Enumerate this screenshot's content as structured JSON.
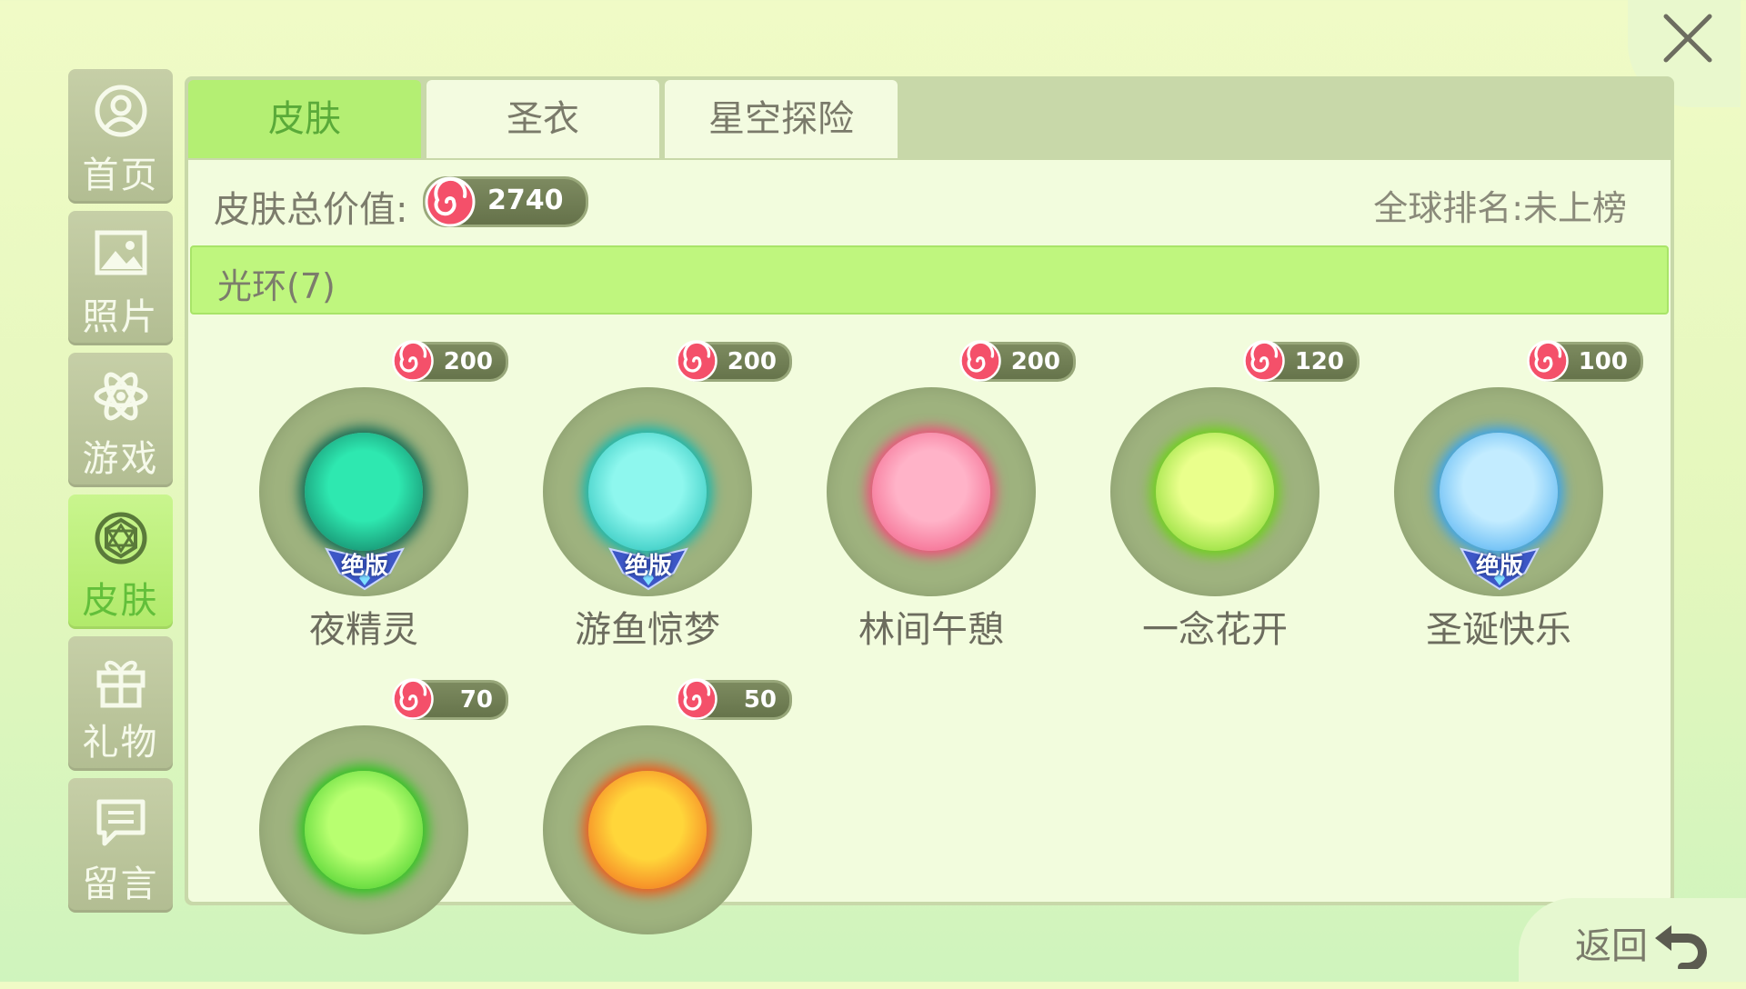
{
  "sidebar": {
    "items": [
      {
        "label": "首页",
        "icon": "profile-icon"
      },
      {
        "label": "照片",
        "icon": "photo-icon"
      },
      {
        "label": "游戏",
        "icon": "atom-icon"
      },
      {
        "label": "皮肤",
        "icon": "skin-icon",
        "active": true
      },
      {
        "label": "礼物",
        "icon": "gift-icon"
      },
      {
        "label": "留言",
        "icon": "message-icon"
      }
    ]
  },
  "tabs": [
    {
      "label": "皮肤",
      "active": true
    },
    {
      "label": "圣衣",
      "active": false
    },
    {
      "label": "星空探险",
      "active": false
    }
  ],
  "summary": {
    "total_label": "皮肤总价值:",
    "total_value": "2740",
    "rank_text": "全球排名:未上榜"
  },
  "category": {
    "label": "光环(7)"
  },
  "items": [
    {
      "name": "夜精灵",
      "price": "200",
      "badge": "绝版",
      "color_inner": "#2ee8b0",
      "color_outer": "#0d6a55"
    },
    {
      "name": "游鱼惊梦",
      "price": "200",
      "badge": "绝版",
      "color_inner": "#8ef7ee",
      "color_outer": "#14b8b0"
    },
    {
      "name": "林间午憩",
      "price": "200",
      "badge": "",
      "color_inner": "#ffb3c8",
      "color_outer": "#f0507c"
    },
    {
      "name": "一念花开",
      "price": "120",
      "badge": "",
      "color_inner": "#eaff8c",
      "color_outer": "#6fd11c"
    },
    {
      "name": "圣诞快乐",
      "price": "100",
      "badge": "绝版",
      "color_inner": "#c3ecff",
      "color_outer": "#39a4ef"
    },
    {
      "name": "",
      "price": "70",
      "badge": "",
      "color_inner": "#b8ff70",
      "color_outer": "#2fc41e"
    },
    {
      "name": "",
      "price": "50",
      "badge": "",
      "color_inner": "#ffd63a",
      "color_outer": "#f05a1a"
    }
  ],
  "back": {
    "label": "返回"
  },
  "colors": {
    "accent": "#b4ef73",
    "panel": "#c8d8a9",
    "pill": "#6d7a52"
  }
}
